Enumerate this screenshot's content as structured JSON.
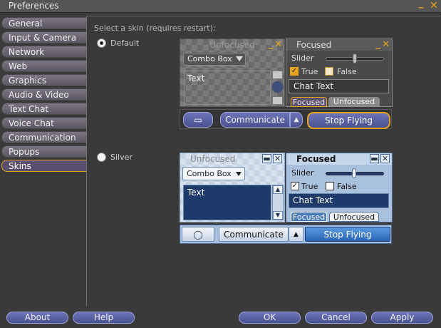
{
  "window": {
    "title": "Preferences",
    "minimize_glyph": "_",
    "close_glyph": "✕"
  },
  "sidebar": {
    "items": [
      {
        "label": "General"
      },
      {
        "label": "Input & Camera"
      },
      {
        "label": "Network"
      },
      {
        "label": "Web"
      },
      {
        "label": "Graphics"
      },
      {
        "label": "Audio & Video"
      },
      {
        "label": "Text Chat"
      },
      {
        "label": "Voice Chat"
      },
      {
        "label": "Communication"
      },
      {
        "label": "Popups"
      },
      {
        "label": "Skins"
      }
    ],
    "selected": "Skins"
  },
  "skins": {
    "hint": "Select a skin (requires restart):",
    "options": [
      {
        "label": "Default",
        "selected": true
      },
      {
        "label": "Silver",
        "selected": false
      }
    ],
    "preview": {
      "unfocused_title": "Unfocused",
      "focused_title": "Focused",
      "combo_label": "Combo Box",
      "text_label": "Text",
      "slider_label": "Slider",
      "slider_value": 0.55,
      "check_true_label": "True",
      "check_false_label": "False",
      "check_true_checked": true,
      "check_false_checked": false,
      "chat_text": "Chat Text",
      "tab_focused": "Focused",
      "tab_unfocused": "Unfocused",
      "communicate_label": "Communicate",
      "stop_flying_label": "Stop Flying"
    }
  },
  "buttons": {
    "about": "About",
    "help": "Help",
    "ok": "OK",
    "cancel": "Cancel",
    "apply": "Apply"
  },
  "colors": {
    "accent": "#e8a41c",
    "button_blue": "#4a528f",
    "silver_blue": "#1e3a6a"
  }
}
